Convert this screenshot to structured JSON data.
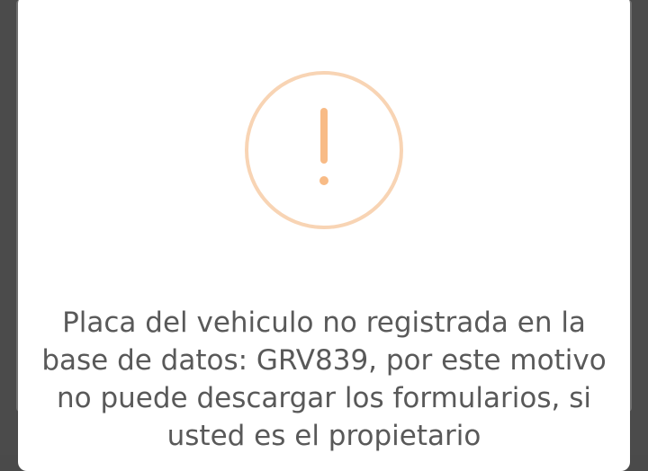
{
  "dialog": {
    "icon": "warning-exclamation-icon",
    "icon_color": "#f8bb86",
    "message": "Placa del vehiculo no registrada en la base de datos: GRV839, por este motivo no puede descargar los formularios, si usted es el propietario"
  }
}
